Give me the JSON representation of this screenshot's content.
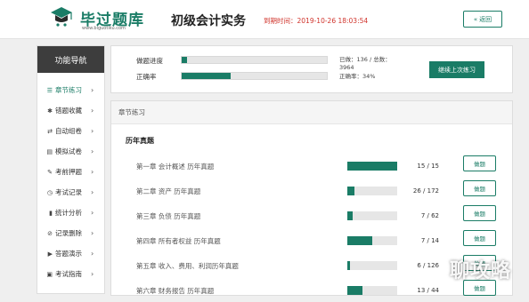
{
  "header": {
    "logo_text": "毕过题库",
    "logo_url": "www.biguotiku.com",
    "title": "初级会计实务",
    "expire": "到期时间：2019-10-26 18:03:54",
    "back_label": "返回"
  },
  "sidebar": {
    "title": "功能导航",
    "items": [
      {
        "label": "章节练习",
        "icon": "list-icon"
      },
      {
        "label": "错题收藏",
        "icon": "star-icon"
      },
      {
        "label": "自动组卷",
        "icon": "shuffle-icon"
      },
      {
        "label": "模拟试卷",
        "icon": "paper-icon"
      },
      {
        "label": "考前押题",
        "icon": "pushpin-icon"
      },
      {
        "label": "考试记录",
        "icon": "clock-icon"
      },
      {
        "label": "统计分析",
        "icon": "bar-chart-icon"
      },
      {
        "label": "记录删除",
        "icon": "block-icon"
      },
      {
        "label": "答题演示",
        "icon": "play-icon"
      },
      {
        "label": "考试指南",
        "icon": "briefcase-icon"
      }
    ]
  },
  "progress": {
    "progress_label": "做题进度",
    "accuracy_label": "正确率",
    "progress_fraction": 0.034,
    "accuracy_fraction": 0.34,
    "done_line1": "已做：136 / 总数：",
    "done_line2": "3964",
    "accuracy_text": "正确率：34%",
    "continue_label": "继续上次练习"
  },
  "chapters": {
    "panel_title": "章节练习",
    "section_title": "历年真题",
    "do_label": "做题",
    "rows": [
      {
        "name": "第一章 会计概述 历年真题",
        "count": "15 / 15",
        "fraction": 1.0
      },
      {
        "name": "第二章 资产 历年真题",
        "count": "26 / 172",
        "fraction": 0.151
      },
      {
        "name": "第三章 负债 历年真题",
        "count": "7 / 62",
        "fraction": 0.113
      },
      {
        "name": "第四章 所有者权益 历年真题",
        "count": "7 / 14",
        "fraction": 0.5
      },
      {
        "name": "第五章 收入、费用、利润历年真题",
        "count": "6 / 126",
        "fraction": 0.048
      },
      {
        "name": "第六章 财务报告 历年真题",
        "count": "13 / 44",
        "fraction": 0.295
      }
    ]
  },
  "watermark": "聊攻略",
  "colors": {
    "accent": "#1a7c66",
    "expire": "#d0342c",
    "sidebar_head": "#3d3d3d"
  }
}
